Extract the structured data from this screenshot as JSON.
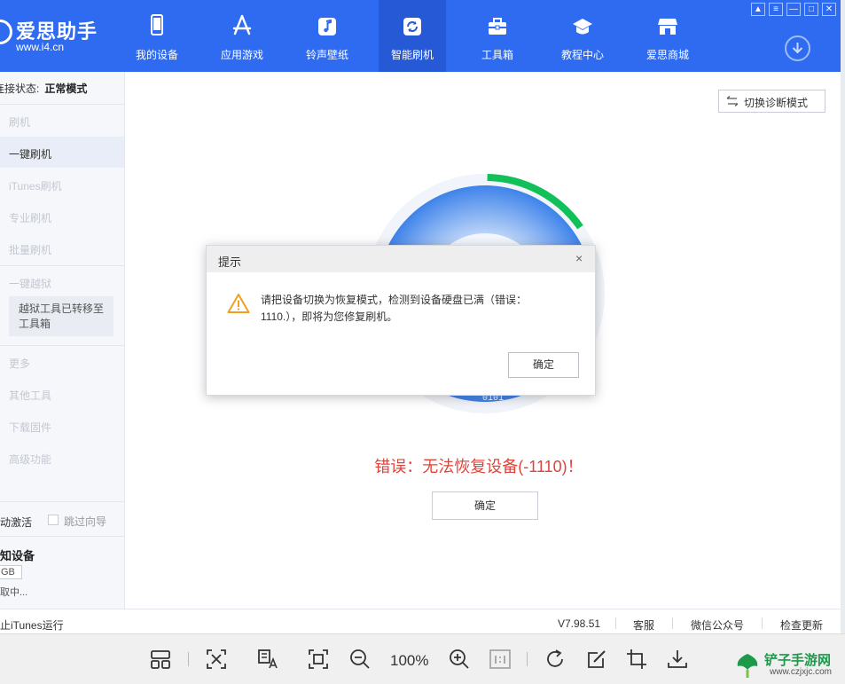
{
  "app": {
    "logo_name": "爱思助手",
    "logo_url": "www.i4.cn"
  },
  "nav": [
    {
      "label": "我的设备",
      "icon": "phone-icon"
    },
    {
      "label": "应用游戏",
      "icon": "app-store-icon"
    },
    {
      "label": "铃声壁纸",
      "icon": "music-icon"
    },
    {
      "label": "智能刷机",
      "icon": "refresh-icon",
      "active": true
    },
    {
      "label": "工具箱",
      "icon": "toolbox-icon"
    },
    {
      "label": "教程中心",
      "icon": "graduation-cap-icon"
    },
    {
      "label": "爱思商城",
      "icon": "shop-icon"
    }
  ],
  "sidebar": {
    "connection_label": "连接状态:",
    "connection_value": "正常模式",
    "items": [
      {
        "label": "刷机",
        "enabled": false
      },
      {
        "label": "一键刷机",
        "enabled": true,
        "selected": true
      },
      {
        "label": "iTunes刷机",
        "enabled": false
      },
      {
        "label": "专业刷机",
        "enabled": false
      },
      {
        "label": "批量刷机",
        "enabled": false
      },
      {
        "label": "一键越狱",
        "enabled": false
      }
    ],
    "jailbreak_note": "越狱工具已转移至工具箱",
    "more_items": [
      {
        "label": "更多"
      },
      {
        "label": "其他工具"
      },
      {
        "label": "下载固件"
      },
      {
        "label": "高级功能"
      }
    ],
    "auto_activate": "自动激活",
    "skip_guide": "跳过向导",
    "device_name": "未知设备",
    "device_capacity": "GB",
    "device_status": "获取中..."
  },
  "main": {
    "switch_mode_label": "切换诊断模式",
    "disc_text": "0101",
    "error_message": "错误：无法恢复设备(-1110)！",
    "ok_label": "确定",
    "progress": 0.15
  },
  "dialog": {
    "title": "提示",
    "close": "×",
    "message": "请把设备切换为恢复模式，检测到设备硬盘已满（错误：1110.），即将为您修复刷机。",
    "ok_label": "确定"
  },
  "statusbar": {
    "left_text": "阻止iTunes运行",
    "version": "V7.98.51",
    "service": "客服",
    "wechat": "微信公众号",
    "update": "检查更新"
  },
  "viewer": {
    "zoom": "100%"
  },
  "watermark": {
    "name": "铲子手游网",
    "url": "www.czjxjc.com"
  },
  "colors": {
    "brand_blue": "#2e6bf0",
    "error_red": "#e0433a",
    "progress_green": "#12c05a",
    "warning_orange": "#f0a020"
  }
}
